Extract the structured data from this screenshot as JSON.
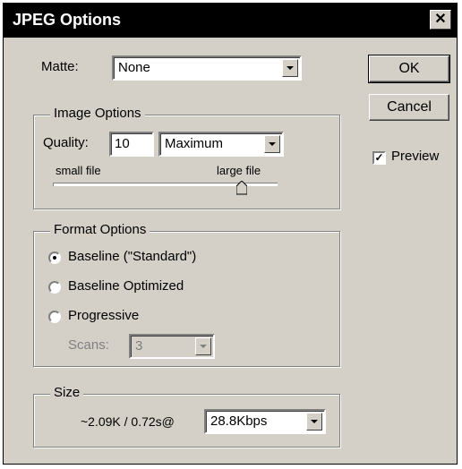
{
  "window": {
    "title": "JPEG Options",
    "close_glyph": "✕"
  },
  "matte": {
    "label": "Matte:",
    "value": "None"
  },
  "buttons": {
    "ok": "OK",
    "cancel": "Cancel"
  },
  "preview": {
    "label": "Preview",
    "checked": true,
    "check_glyph": "✓"
  },
  "image_options": {
    "legend": "Image Options",
    "quality_label": "Quality:",
    "quality_value": "10",
    "quality_preset": "Maximum",
    "slider_min_label": "small file",
    "slider_max_label": "large file",
    "slider_fraction": 0.84
  },
  "format_options": {
    "legend": "Format Options",
    "options": [
      "Baseline (\"Standard\")",
      "Baseline Optimized",
      "Progressive"
    ],
    "selected_index": 0,
    "scans_label": "Scans:",
    "scans_value": "3"
  },
  "size": {
    "legend": "Size",
    "estimate": "~2.09K / 0.72s@",
    "speed": "28.8Kbps"
  }
}
